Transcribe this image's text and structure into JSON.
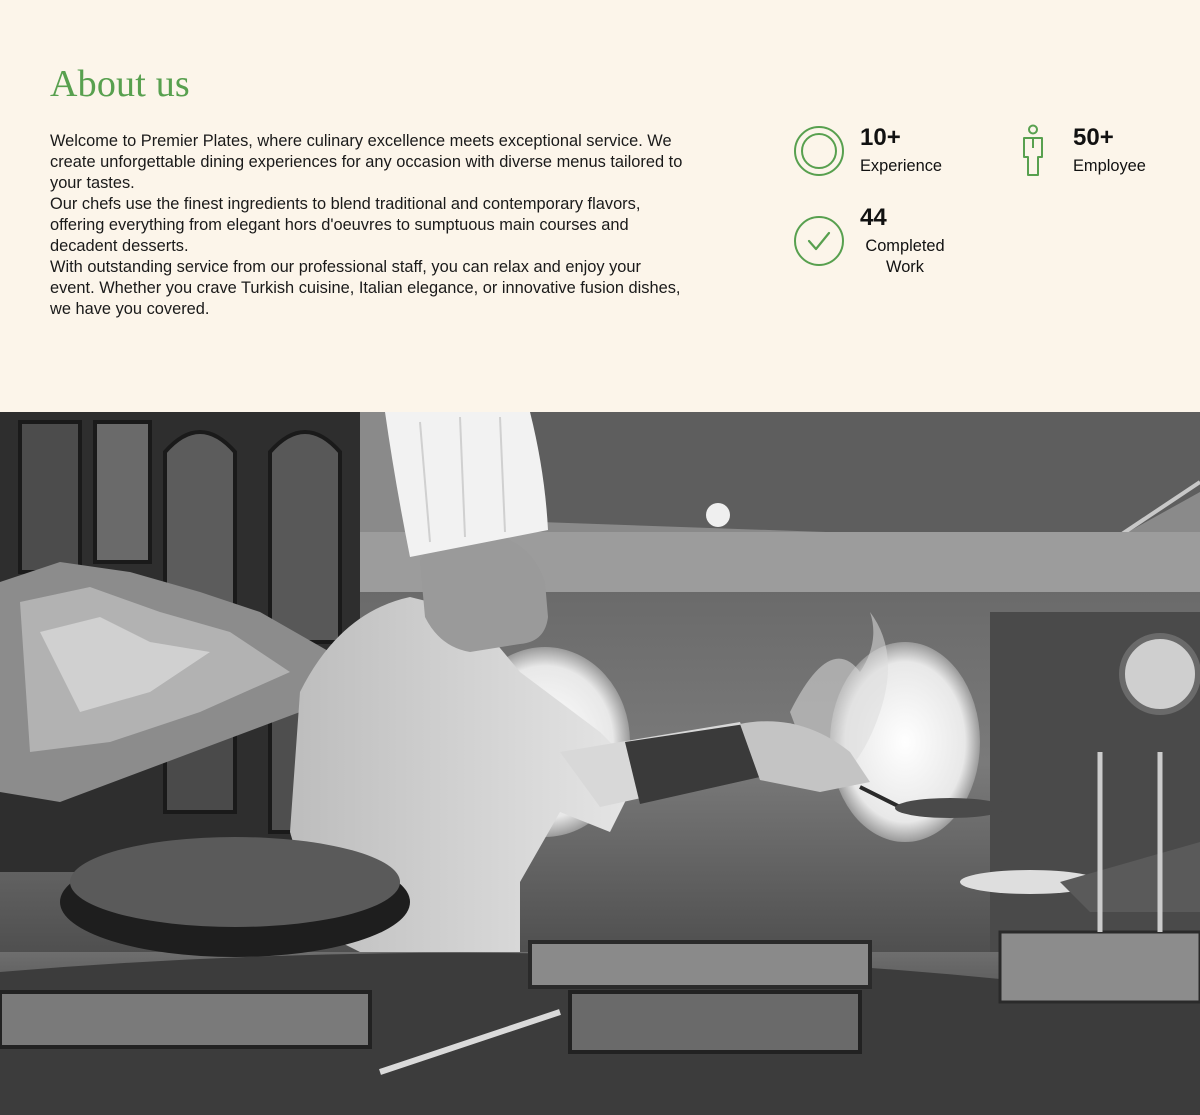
{
  "about": {
    "title": "About us",
    "paragraphs": [
      "Welcome to Premier Plates, where culinary excellence meets exceptional service. We create unforgettable dining experiences for any occasion with diverse menus tailored to your tastes.",
      "Our chefs use the finest ingredients to blend traditional and contemporary flavors, offering everything from elegant hors d'oeuvres to sumptuous main courses and decadent desserts.",
      "With outstanding service from our professional staff, you can relax and enjoy your event. Whether you crave Turkish cuisine, Italian elegance, or innovative fusion dishes, we have you covered."
    ]
  },
  "stats": [
    {
      "value": "10+",
      "label": "Experience",
      "icon": "target-rings-icon"
    },
    {
      "value": "50+",
      "label": "Employee",
      "icon": "person-icon"
    },
    {
      "value": "44",
      "label": "Completed Work",
      "icon": "check-circle-icon"
    }
  ],
  "hero": {
    "image": "chef-cooking-photo"
  },
  "colors": {
    "background": "#fcf5ea",
    "accent": "#58a04f",
    "text": "#111111"
  }
}
